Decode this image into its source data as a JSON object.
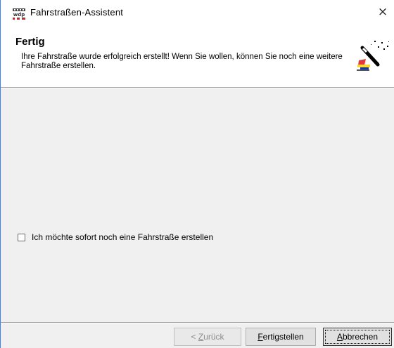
{
  "window": {
    "title": "Fahrstraßen-Assistent",
    "app_icon": "wdp-app-icon",
    "close_icon": "close-icon",
    "close_glyph": "×"
  },
  "header": {
    "title": "Fertig",
    "description": "Ihre Fahrstraße wurde erfolgreich erstellt! Wenn Sie wollen, können Sie noch eine weitere Fahrstraße erstellen.",
    "icon": "magic-wand-icon"
  },
  "options": {
    "create_another": {
      "label": "Ich möchte sofort noch eine Fahrstraße erstellen",
      "checked": false
    }
  },
  "buttons": {
    "back": {
      "prefix": "< ",
      "mnemonic": "Z",
      "rest": "urück",
      "enabled": false
    },
    "finish": {
      "mnemonic": "F",
      "rest": "ertigstellen",
      "enabled": true
    },
    "cancel": {
      "mnemonic": "A",
      "rest": "bbrechen",
      "enabled": true,
      "default": true
    }
  }
}
